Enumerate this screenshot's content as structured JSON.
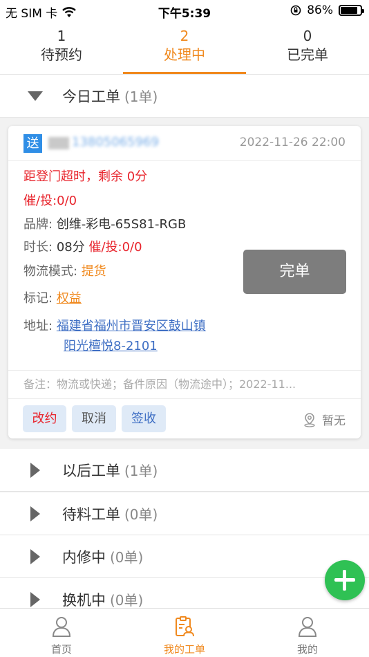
{
  "status_bar": {
    "carrier": "无 SIM 卡",
    "time": "下午5:39",
    "battery": "86%",
    "battery_level": 0.86
  },
  "top_tabs": [
    {
      "count": "1",
      "label": "待预约",
      "active": false
    },
    {
      "count": "2",
      "label": "处理中",
      "active": true
    },
    {
      "count": "0",
      "label": "已完单",
      "active": false
    }
  ],
  "sections": {
    "today": {
      "title": "今日工单",
      "count": "(1单)"
    },
    "later": {
      "title": "以后工单",
      "count": "(1单)"
    },
    "pending_parts": {
      "title": "待料工单",
      "count": "(0单)"
    },
    "repair": {
      "title": "内修中",
      "count": "(0单)"
    },
    "exchange": {
      "title": "换机中",
      "count": "(0单)"
    }
  },
  "card": {
    "badge": "送",
    "phone": "13805065969",
    "date": "2022-11-26 22:00",
    "overtime": "距登门超时，剩余 0分",
    "urge": "催/投:0/0",
    "brand_label": "品牌:",
    "brand_value": "创维-彩电-65S81-RGB",
    "duration_label": "时长:",
    "duration_value": "08分",
    "duration_urge": "催/投:0/0",
    "logistics_label": "物流模式:",
    "logistics_value": "提货",
    "mark_label": "标记:",
    "mark_value": "权益",
    "address_label": "地址:",
    "address_line1": "福建省福州市晋安区鼓山镇",
    "address_line2": "阳光檀悦8-2101",
    "finish_button": "完单",
    "note": "备注：物流或快递；备件原因（物流途中）；2022-11...",
    "actions": {
      "reschedule": "改约",
      "cancel": "取消",
      "sign": "签收"
    },
    "location": "暂无"
  },
  "bottom_nav": [
    {
      "label": "首页",
      "icon": "person-icon",
      "active": false
    },
    {
      "label": "我的工单",
      "icon": "work-order-icon",
      "active": true
    },
    {
      "label": "我的",
      "icon": "person-icon",
      "active": false
    }
  ],
  "colors": {
    "accent": "#f0891e",
    "alert": "#e8242c",
    "link": "#3f6fc4",
    "fab": "#2fc154",
    "badge": "#2f8ee6"
  }
}
